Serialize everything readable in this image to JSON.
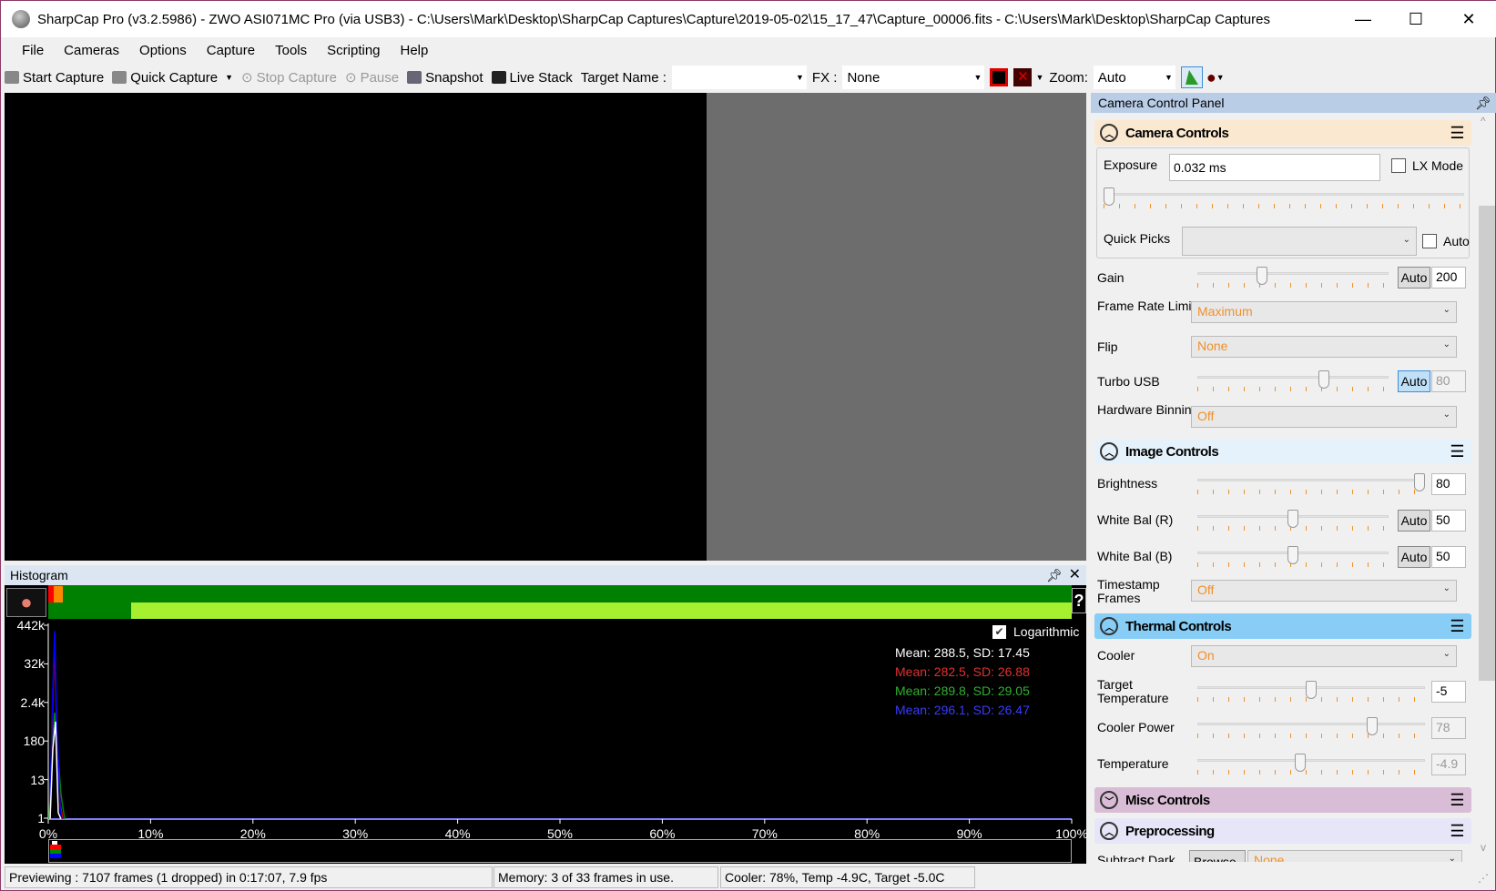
{
  "window": {
    "title": "SharpCap Pro (v3.2.5986) - ZWO ASI071MC Pro (via USB3) - C:\\Users\\Mark\\Desktop\\SharpCap Captures\\Capture\\2019-05-02\\15_17_47\\Capture_00006.fits - C:\\Users\\Mark\\Desktop\\SharpCap Captures",
    "minimize": "—",
    "maximize": "☐",
    "close": "✕"
  },
  "menu": [
    "File",
    "Cameras",
    "Options",
    "Capture",
    "Tools",
    "Scripting",
    "Help"
  ],
  "toolbar": {
    "start_capture": "Start Capture",
    "quick_capture": "Quick Capture",
    "stop_capture": "Stop Capture",
    "pause": "Pause",
    "snapshot": "Snapshot",
    "live_stack": "Live Stack",
    "target_name_label": "Target Name :",
    "target_name_value": "",
    "fx_label": "FX :",
    "fx_value": "None",
    "zoom_label": "Zoom:",
    "zoom_value": "Auto"
  },
  "histogram": {
    "title": "Histogram",
    "help": "?",
    "logarithmic_label": "Logarithmic",
    "logarithmic": true,
    "y_ticks": [
      "442k",
      "32k",
      "2.4k",
      "180",
      "13",
      "1"
    ],
    "x_ticks": [
      "0%",
      "10%",
      "20%",
      "30%",
      "40%",
      "50%",
      "60%",
      "70%",
      "80%",
      "90%",
      "100%"
    ],
    "stats": [
      {
        "text": "Mean: 288.5, SD: 17.45",
        "color": "#ffffff"
      },
      {
        "text": "Mean: 282.5, SD: 26.88",
        "color": "#e03030"
      },
      {
        "text": "Mean: 289.8, SD: 29.05",
        "color": "#30b030"
      },
      {
        "text": "Mean: 296.1, SD: 26.47",
        "color": "#3a3aff"
      }
    ]
  },
  "status": {
    "previewing": "Previewing : 7107 frames (1 dropped) in 0:17:07, 7.9 fps",
    "memory": "Memory: 3 of 33 frames in use.",
    "cooler": "Cooler: 78%, Temp -4.9C, Target -5.0C"
  },
  "panel": {
    "title": "Camera Control Panel",
    "camera_controls": {
      "title": "Camera Controls",
      "exposure_label": "Exposure",
      "exposure_value": "0.032 ms",
      "lx_mode": "LX Mode",
      "lx_checked": false,
      "exposure_level": 0,
      "quick_picks_label": "Quick Picks",
      "quick_picks_value": "",
      "quick_auto": "Auto",
      "gain_label": "Gain",
      "gain_auto": "Auto",
      "gain_value": "200",
      "gain_level": 0.33,
      "frame_rate_label": "Frame Rate Limit",
      "frame_rate_value": "Maximum",
      "flip_label": "Flip",
      "flip_value": "None",
      "turbo_label": "Turbo USB",
      "turbo_auto": "Auto",
      "turbo_value": "80",
      "turbo_level": 0.67,
      "binning_label": "Hardware Binning",
      "binning_value": "Off"
    },
    "image_controls": {
      "title": "Image Controls",
      "brightness_label": "Brightness",
      "brightness_value": "80",
      "brightness_level": 1.0,
      "wbr_label": "White Bal (R)",
      "wbr_auto": "Auto",
      "wbr_value": "50",
      "wbr_level": 0.5,
      "wbb_label": "White Bal (B)",
      "wbb_auto": "Auto",
      "wbb_value": "50",
      "wbb_level": 0.5,
      "timestamp_label": "Timestamp Frames",
      "timestamp_value": "Off"
    },
    "thermal_controls": {
      "title": "Thermal Controls",
      "cooler_label": "Cooler",
      "cooler_value": "On",
      "target_label": "Target Temperature",
      "target_value": "-5",
      "target_level": 0.5,
      "power_label": "Cooler Power",
      "power_value": "78",
      "power_level": 0.78,
      "temp_label": "Temperature",
      "temp_value": "-4.9",
      "temp_level": 0.45
    },
    "misc_controls": {
      "title": "Misc Controls"
    },
    "preprocessing": {
      "title": "Preprocessing",
      "subtract_dark_label": "Subtract Dark",
      "browse": "Browse",
      "dark_value": "None"
    }
  },
  "colors": {
    "camera_header": "#fbe8d0",
    "image_header": "#e6f2fb",
    "thermal_header": "#87cdf5",
    "misc_header": "#d9bdd6",
    "pre_header": "#e6e6f8",
    "dropdown_text": "#f0902a"
  }
}
